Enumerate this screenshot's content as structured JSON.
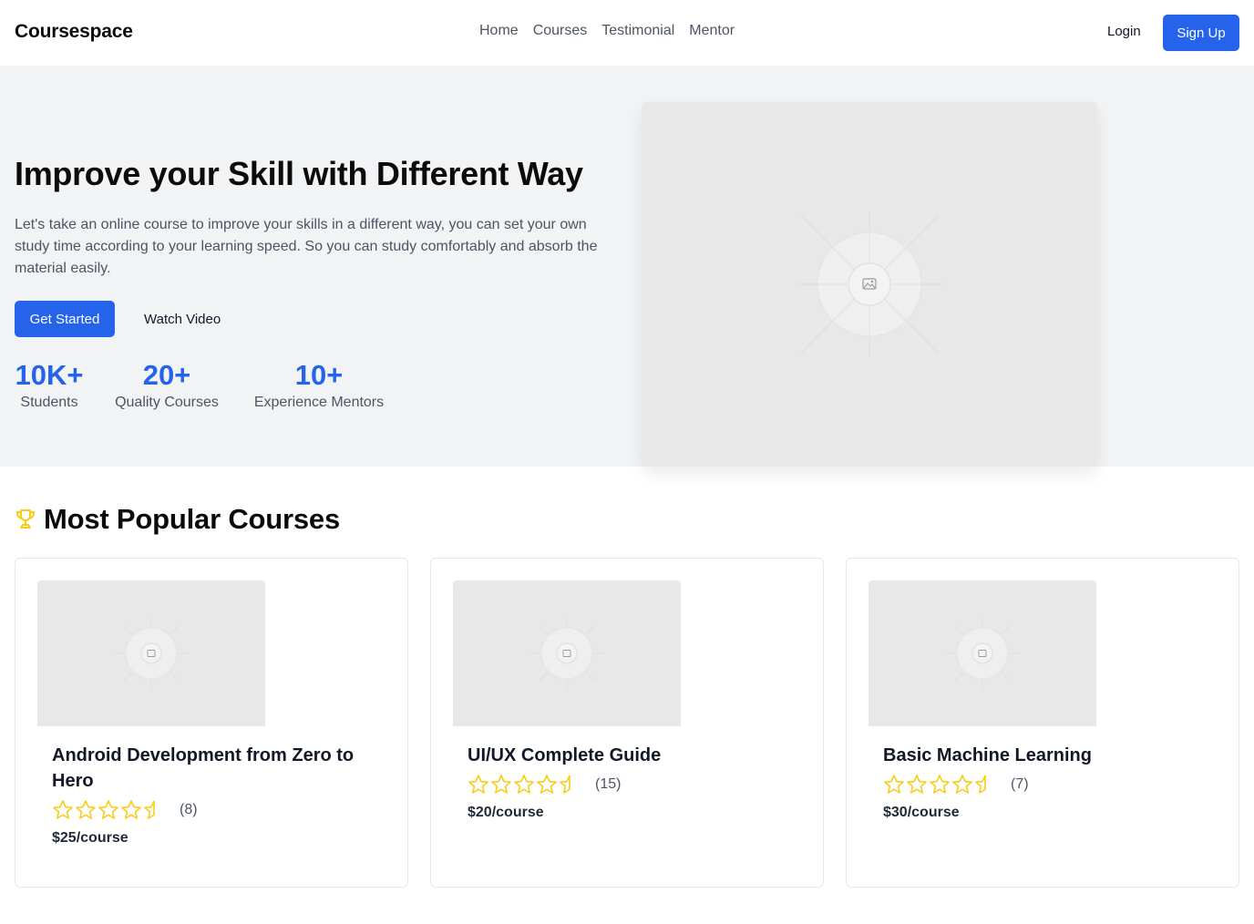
{
  "header": {
    "logo": "Coursespace",
    "nav": [
      "Home",
      "Courses",
      "Testimonial",
      "Mentor"
    ],
    "login_label": "Login",
    "signup_label": "Sign Up"
  },
  "hero": {
    "title": "Improve your Skill with Different Way",
    "description": "Let's take an online course to improve your skills in a different way, you can set your own study time according to your learning speed. So you can study comfortably and absorb the material easily.",
    "primary_button": "Get Started",
    "secondary_button": "Watch Video",
    "stats": [
      {
        "value": "10K+",
        "label": "Students"
      },
      {
        "value": "20+",
        "label": "Quality Courses"
      },
      {
        "value": "10+",
        "label": "Experience Mentors"
      }
    ],
    "image_icon": "image-placeholder-icon"
  },
  "popular": {
    "title": "Most Popular Courses",
    "icon": "trophy-icon",
    "courses": [
      {
        "title": "Android Development from Zero to Hero",
        "rating": 4.5,
        "count": "(8)",
        "price": "$25/course"
      },
      {
        "title": "UI/UX Complete Guide",
        "rating": 4.5,
        "count": "(15)",
        "price": "$20/course"
      },
      {
        "title": "Basic Machine Learning",
        "rating": 4.5,
        "count": "(7)",
        "price": "$30/course"
      }
    ]
  },
  "colors": {
    "accent": "#2563eb",
    "star": "#facc15",
    "hero_bg": "#f1f3f5",
    "placeholder_bg": "#e8e8e8"
  }
}
